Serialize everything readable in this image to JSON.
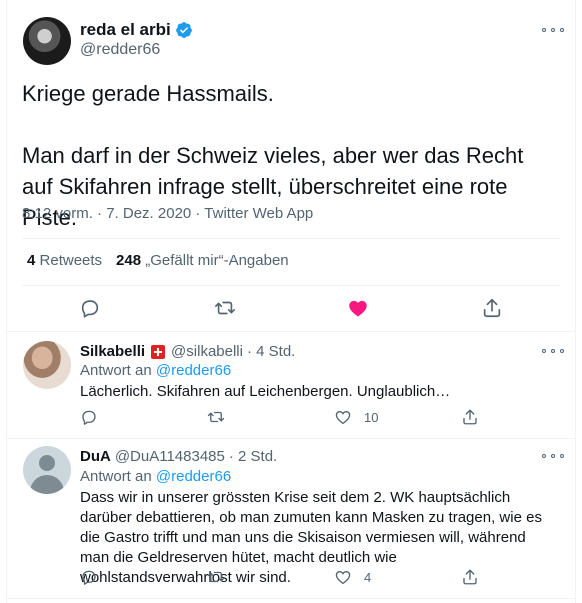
{
  "main_tweet": {
    "name": "reda el arbi",
    "handle": "@redder66",
    "text_line1": "Kriege gerade Hassmails.",
    "text_para2": "Man darf in der Schweiz vieles, aber wer das Recht auf Skifahren infrage stellt, überschreitet eine rote Piste.",
    "meta": "8:12 vorm. · 7. Dez. 2020 · Twitter Web App",
    "retweets_count": "4",
    "retweets_label": "Retweets",
    "likes_count": "248",
    "likes_label": "„Gefällt mir“-Angaben",
    "liked": true,
    "verified": true,
    "icons": [
      "reply-icon",
      "retweet-icon",
      "like-icon",
      "share-icon"
    ]
  },
  "replies": [
    {
      "name": "Silkabelli",
      "flag": "swiss-flag",
      "handle": "@silkabelli",
      "time": "· 4 Std.",
      "reply_to_prefix": "Antwort an",
      "reply_to_handle": "@redder66",
      "text": "Lächerlich. Skifahren auf Leichenbergen. Unglaublich…",
      "reply_count": "",
      "retweet_count": "",
      "like_count": "10"
    },
    {
      "name": "DuA",
      "handle": "@DuA11483485",
      "time": "· 2 Std.",
      "reply_to_prefix": "Antwort an",
      "reply_to_handle": "@redder66",
      "text": "Dass wir in unserer grössten Krise seit dem 2. WK hauptsächlich darüber debattieren, ob man zumuten kann Masken zu tragen, wie es die Gastro trifft und man uns die Skisaison vermiesen will, während man die Geldreserven hütet, macht deutlich wie wohlstandsverwahrlost wir sind.",
      "reply_count": "",
      "retweet_count": "",
      "like_count": "4"
    }
  ],
  "colors": {
    "accent": "#1d9bf0",
    "like_active": "#f91880",
    "secondary_text": "#536471",
    "divider": "#eff3f4"
  }
}
